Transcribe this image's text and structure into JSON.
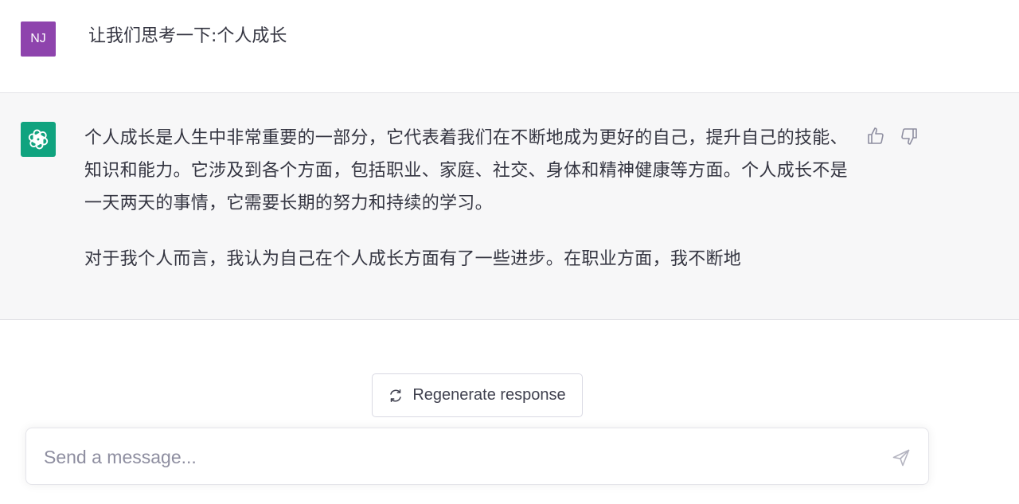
{
  "user_message": {
    "avatar_initials": "NJ",
    "avatar_color": "#8e44ad",
    "text": "让我们思考一下:个人成长"
  },
  "assistant_message": {
    "avatar_icon": "openai-logo-icon",
    "avatar_color": "#10a37f",
    "paragraphs": [
      "个人成长是人生中非常重要的一部分，它代表着我们在不断地成为更好的自己，提升自己的技能、知识和能力。它涉及到各个方面，包括职业、家庭、社交、身体和精神健康等方面。个人成长不是一天两天的事情，它需要长期的努力和持续的学习。",
      "对于我个人而言，我认为自己在个人成长方面有了一些进步。在职业方面，我不断地"
    ],
    "feedback": {
      "thumbs_up_icon": "thumbs-up-icon",
      "thumbs_down_icon": "thumbs-down-icon"
    }
  },
  "regenerate": {
    "label": "Regenerate response",
    "icon": "refresh-icon"
  },
  "composer": {
    "placeholder": "Send a message...",
    "value": "",
    "send_icon": "send-icon"
  }
}
